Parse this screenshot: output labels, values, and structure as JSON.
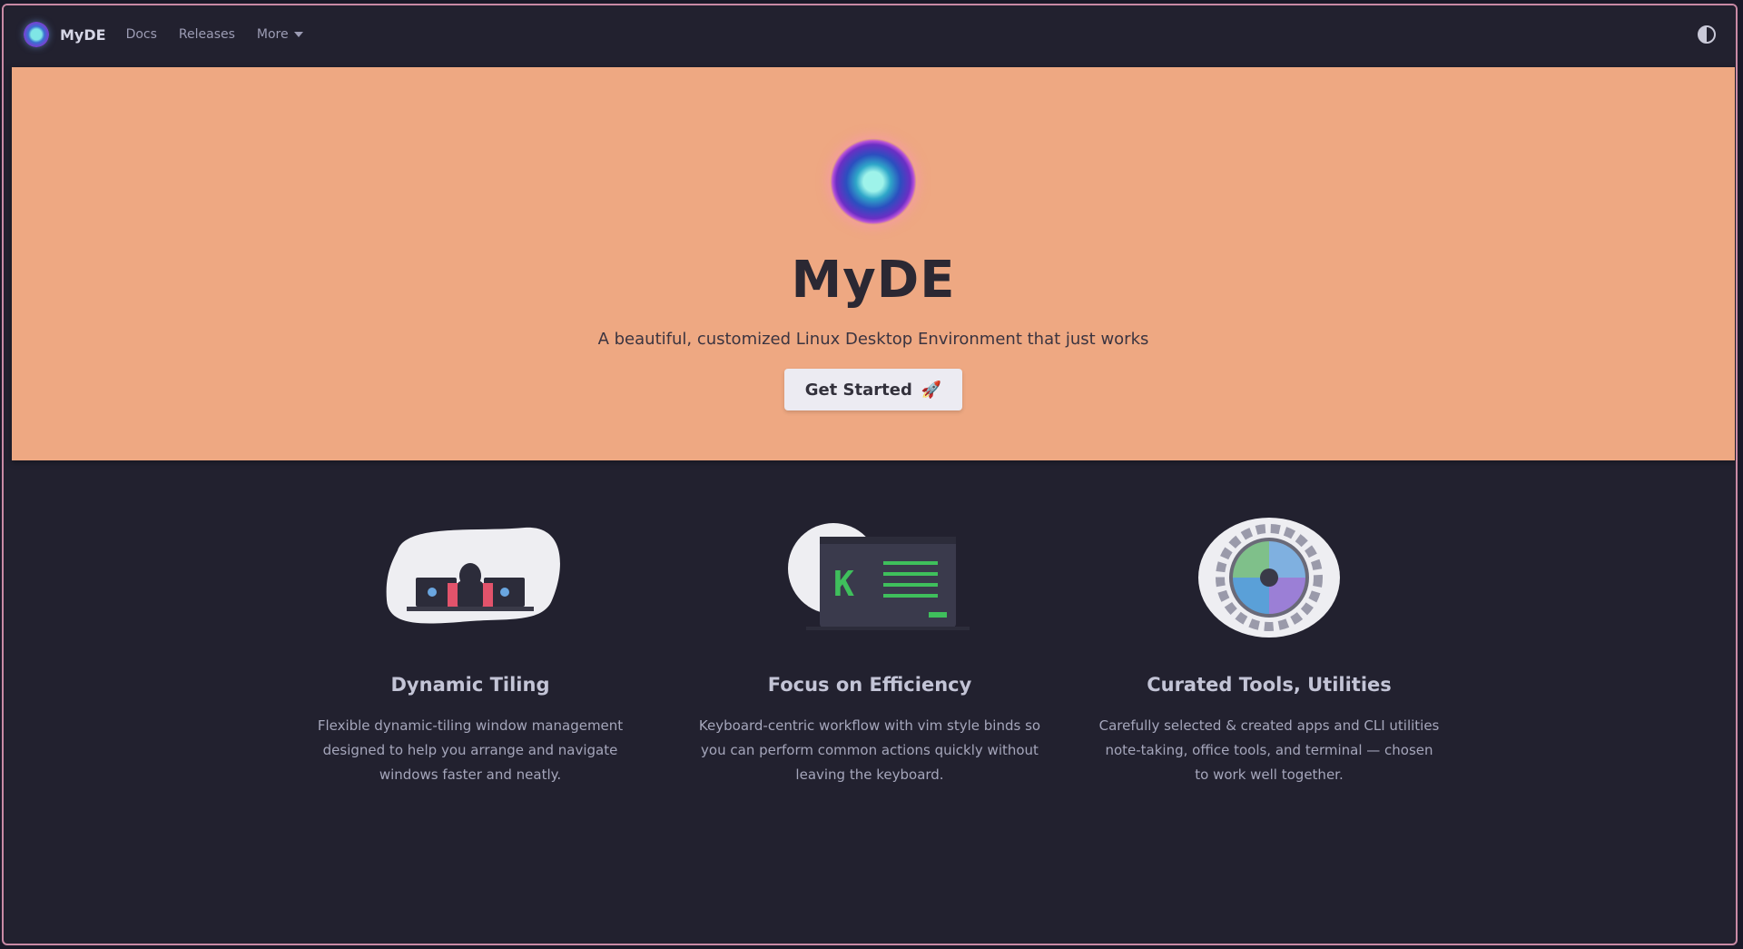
{
  "nav": {
    "brand": "MyDE",
    "links": [
      "Docs",
      "Releases",
      "More"
    ]
  },
  "hero": {
    "title": "MyDE",
    "tagline": "A beautiful, customized Linux Desktop Environment that just works",
    "cta_label": "Get Started",
    "cta_emoji": "🚀",
    "background": "#eea882"
  },
  "features": [
    {
      "title": "Dynamic Tiling",
      "description": "Flexible dynamic-tiling window management designed to help you arrange and navigate windows faster and neatly."
    },
    {
      "title": "Focus on Efficiency",
      "description": "Keyboard-centric workflow with vim style binds so you can perform common actions quickly without leaving the keyboard."
    },
    {
      "title": "Curated Tools, Utilities",
      "description": "Carefully selected & created apps and CLI utilities note-taking, office tools, and terminal — chosen to work well together."
    }
  ],
  "colors": {
    "accent": "#eea882",
    "background": "#22212f",
    "frame": "#c98aa5"
  }
}
